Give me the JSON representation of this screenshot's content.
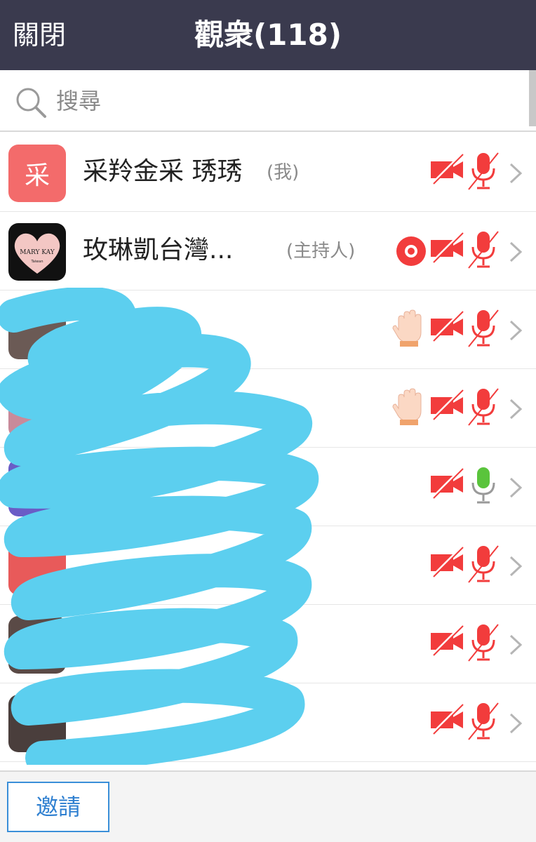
{
  "header": {
    "close_label": "關閉",
    "title": "觀衆(118)"
  },
  "search": {
    "placeholder": "搜尋"
  },
  "participants": [
    {
      "name": "采羚金采 琇琇",
      "tag": "(我)",
      "avatar_text": "采",
      "avatar_color": "#f36b6b",
      "video_off": true,
      "mic_on": false
    },
    {
      "name": "玫琳凱台灣...",
      "tag": "(主持人)",
      "avatar_text": "MARY KAY",
      "avatar_subtext": "Taiwan",
      "recording": true,
      "video_off": true,
      "mic_on": false
    },
    {
      "hand_raised": true,
      "video_off": true,
      "mic_on": false
    },
    {
      "hand_raised": true,
      "video_off": true,
      "mic_on": false
    },
    {
      "video_off": true,
      "mic_on": true
    },
    {
      "video_off": true,
      "mic_on": false
    },
    {
      "video_off": true,
      "mic_on": false
    },
    {
      "video_off": true,
      "mic_on": false
    }
  ],
  "footer": {
    "invite_label": "邀請"
  },
  "colors": {
    "header_bg": "#3a3a4e",
    "muted_red": "#f23c3c",
    "mic_green": "#5ac43c",
    "scribble": "#5ccfef",
    "invite_blue": "#2e7fd0"
  }
}
